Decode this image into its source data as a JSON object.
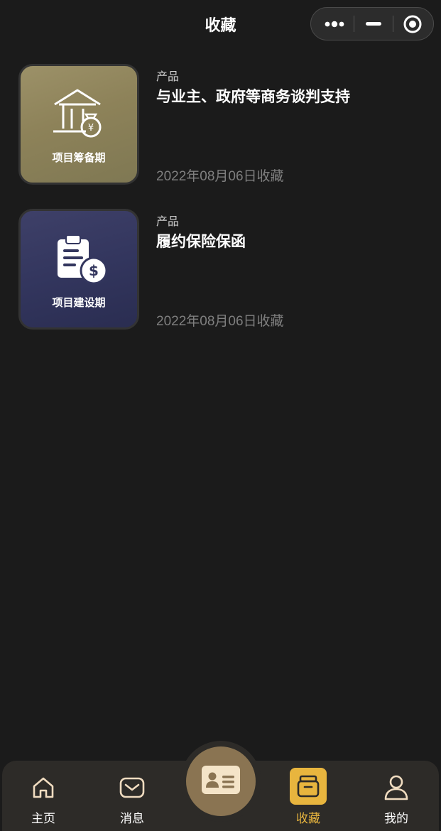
{
  "header": {
    "title": "收藏"
  },
  "capsule": {
    "more_icon": "more-dots-icon",
    "minimize_icon": "minimize-icon",
    "close_icon": "target-icon"
  },
  "favorites": [
    {
      "thumb_label": "项目筹备期",
      "thumb_icon": "house-money-icon",
      "category": "产品",
      "title": "与业主、政府等商务谈判支持",
      "date": "2022年08月06日收藏"
    },
    {
      "thumb_label": "项目建设期",
      "thumb_icon": "clipboard-dollar-icon",
      "category": "产品",
      "title": "履约保险保函",
      "date": "2022年08月06日收藏"
    }
  ],
  "tabbar": {
    "items": [
      {
        "label": "主页",
        "icon": "home-icon"
      },
      {
        "label": "消息",
        "icon": "mail-icon"
      },
      {
        "label": "",
        "icon": "id-card-icon"
      },
      {
        "label": "收藏",
        "icon": "archive-box-icon",
        "active": true
      },
      {
        "label": "我的",
        "icon": "user-icon"
      }
    ]
  },
  "colors": {
    "background": "#1b1b1b",
    "accent": "#e8b53e",
    "tabbar": "#2d2b28",
    "center_button": "#8a7452"
  }
}
